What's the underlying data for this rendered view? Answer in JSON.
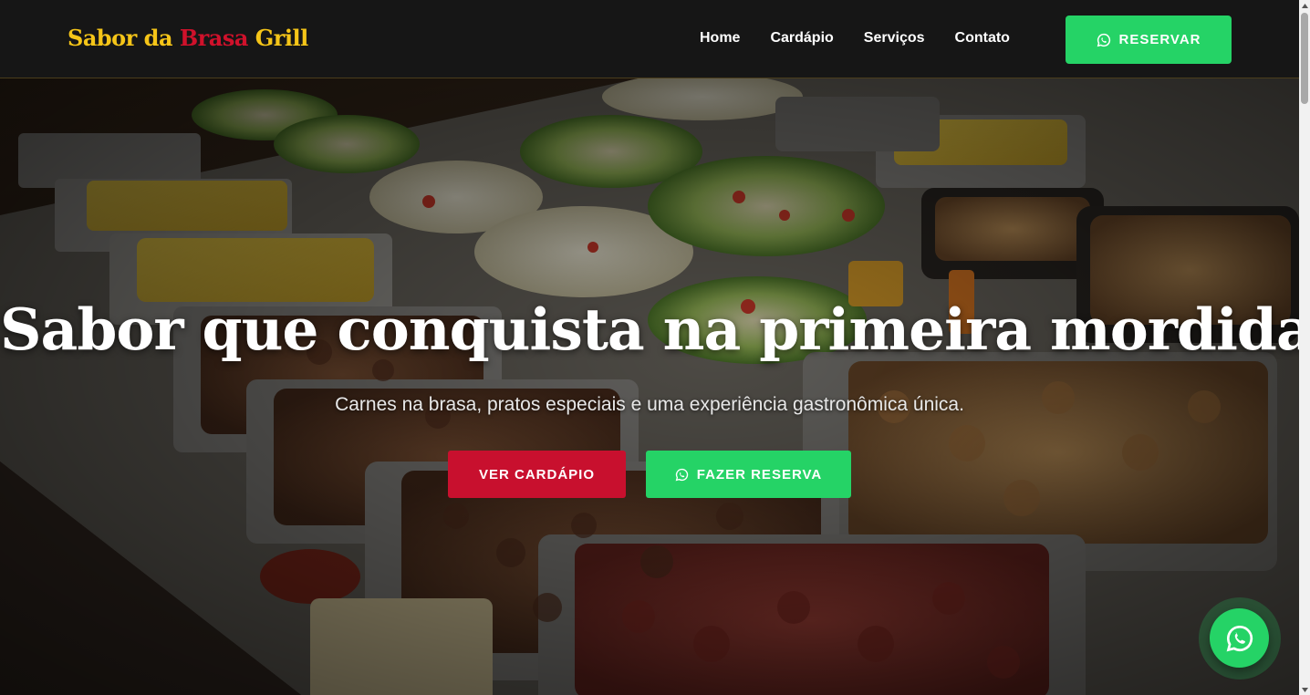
{
  "brand": {
    "part1": "Sabor da ",
    "part2": "Brasa",
    "part3": " Grill",
    "color_gold": "#f5c518",
    "color_red": "#d0112b"
  },
  "nav": {
    "items": [
      {
        "label": "Home"
      },
      {
        "label": "Cardápio"
      },
      {
        "label": "Serviços"
      },
      {
        "label": "Contato"
      }
    ],
    "reserve_label": "RESERVAR",
    "reserve_icon": "whatsapp-icon"
  },
  "hero": {
    "title": "Sabor que conquista na primeira mordida",
    "subtitle": "Carnes na brasa, pratos especiais e uma experiência gastronômica única.",
    "primary_button": "VER CARDÁPIO",
    "secondary_button": "FAZER RESERVA",
    "secondary_icon": "whatsapp-icon",
    "background_image": "buffet-food-trays-photo"
  },
  "floating": {
    "icon": "whatsapp-icon"
  },
  "colors": {
    "header_bg": "#161616",
    "accent_red": "#c8102e",
    "whatsapp_green": "#25d366"
  }
}
